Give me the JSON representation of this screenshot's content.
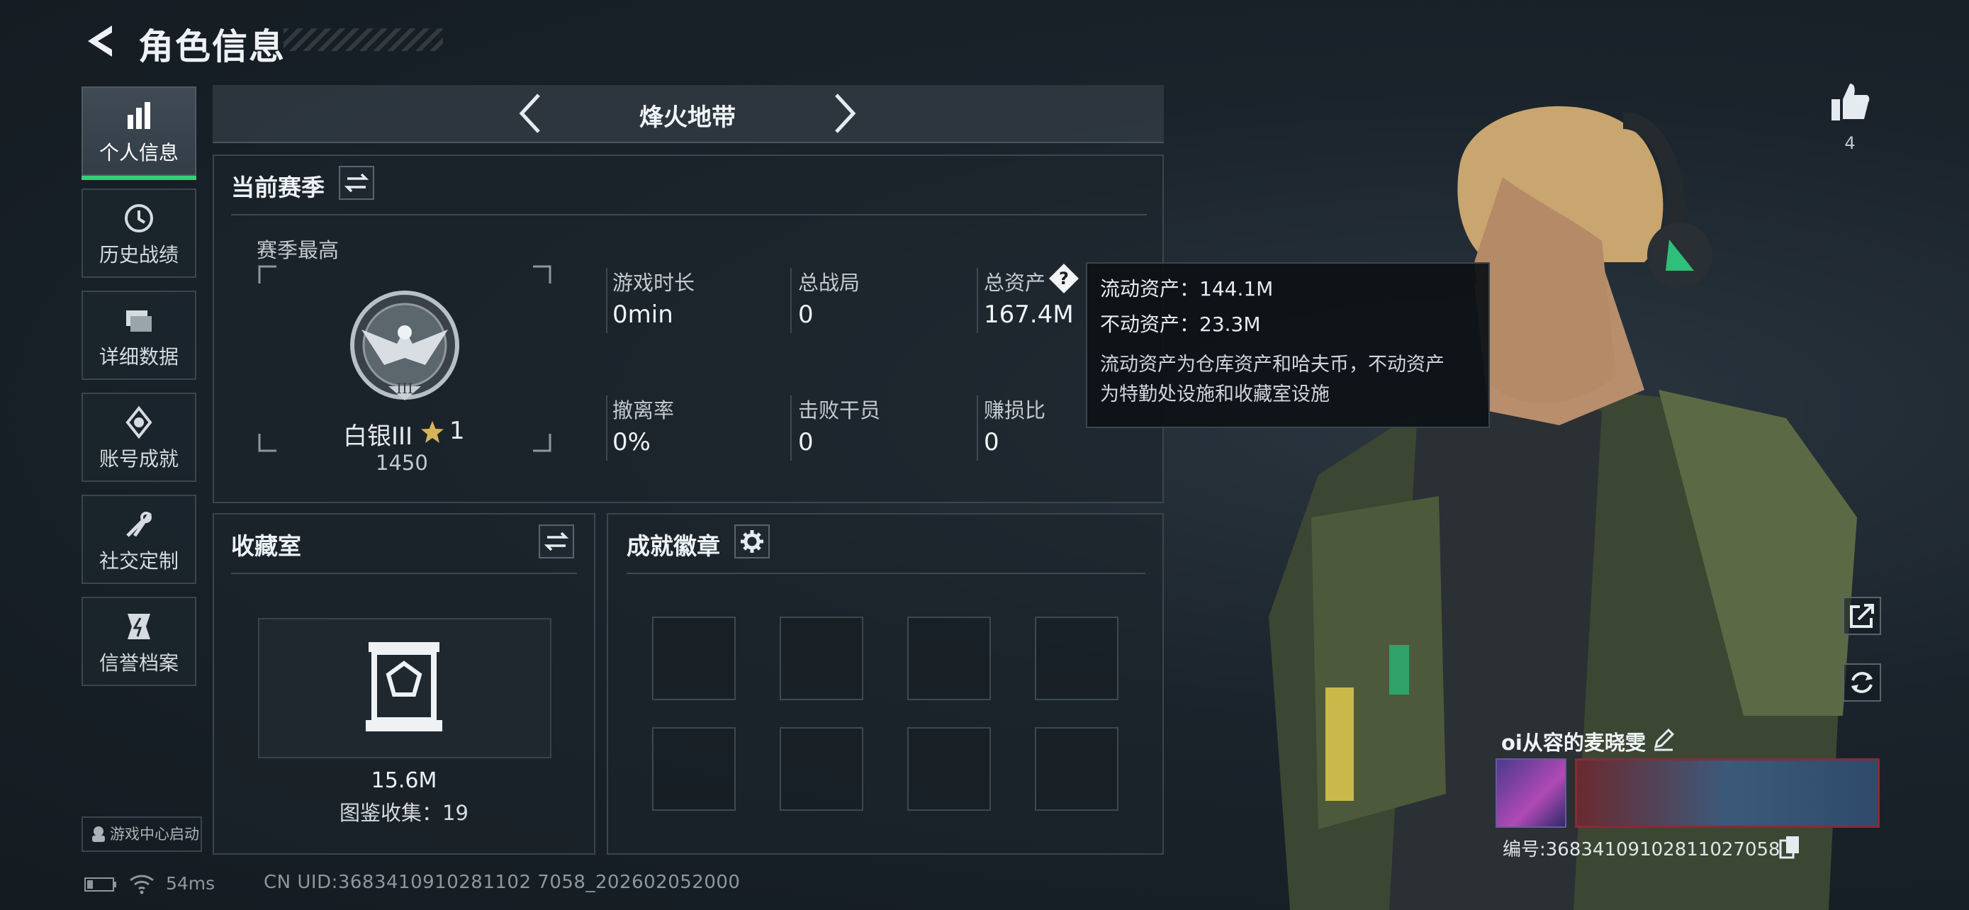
{
  "header": {
    "title": "角色信息"
  },
  "sidebar": {
    "items": [
      {
        "label": "个人信息",
        "icon": "bar-chart-icon",
        "active": true
      },
      {
        "label": "历史战绩",
        "icon": "history-clock-icon"
      },
      {
        "label": "详细数据",
        "icon": "folder-icon"
      },
      {
        "label": "账号成就",
        "icon": "achievement-icon"
      },
      {
        "label": "社交定制",
        "icon": "tools-icon"
      },
      {
        "label": "信誉档案",
        "icon": "credit-icon"
      }
    ],
    "launch_label": "游戏中心启动"
  },
  "mode": {
    "name": "烽火地带"
  },
  "season": {
    "title": "当前赛季",
    "best_label": "赛季最高",
    "rank_name": "白银III",
    "rank_stars": "1",
    "rank_score": "1450",
    "stats": [
      {
        "label": "游戏时长",
        "value": "0min"
      },
      {
        "label": "总战局",
        "value": "0"
      },
      {
        "label": "总资产",
        "value": "167.4M"
      },
      {
        "label": "撤离率",
        "value": "0%"
      },
      {
        "label": "击败干员",
        "value": "0"
      },
      {
        "label": "赚损比",
        "value": "0"
      }
    ]
  },
  "tooltip": {
    "liquid": "流动资产：144.1M",
    "fixed": "不动资产：23.3M",
    "desc_line1": "流动资产为仓库资产和哈夫币，不动资产",
    "desc_line2": "为特勤处设施和收藏室设施"
  },
  "collection": {
    "title": "收藏室",
    "value": "15.6M",
    "catalog": "图鉴收集：19"
  },
  "badges": {
    "title": "成就徽章"
  },
  "player": {
    "name": "oi从容的麦晓雯",
    "id_text": "编号:368341091028110270​58",
    "likes": "4"
  },
  "status": {
    "ping": "54ms",
    "uid": "CN UID:3683410910281102 7058_202602052000"
  },
  "colors": {
    "accent": "#35d07a",
    "panel_border": "#3a454f"
  }
}
